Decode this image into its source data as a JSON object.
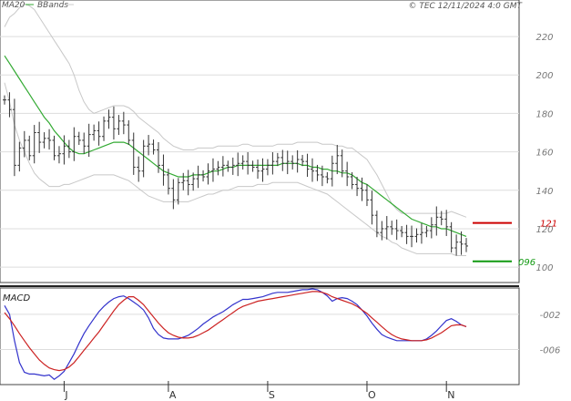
{
  "legend": {
    "ma20": "MA20",
    "bbands": "BBands"
  },
  "copyright": "© TEC 12/11/2024 4:0 GMT",
  "macd_title": "MACD",
  "colors": {
    "price": "#333333",
    "ma20": "#33aa33",
    "bbands": "#c8c8c8",
    "macd": "#3333cc",
    "signal": "#cc2222",
    "resistance": "#cc0000",
    "support": "#119911",
    "grid": "#dddddd"
  },
  "chart_data": [
    {
      "type": "ohlc",
      "title": "",
      "x_months": [
        "J",
        "A",
        "S",
        "O",
        "N"
      ],
      "ylim": [
        92,
        239
      ],
      "y_ticks": [
        "100",
        "120",
        "140",
        "160",
        "180",
        "200",
        "220"
      ],
      "grid": true,
      "legend_position": "top-left",
      "levels": [
        {
          "name": "resistance",
          "label": "121",
          "value": 123
        },
        {
          "name": "support",
          "label": "096",
          "value": 103
        }
      ],
      "closes": [
        187,
        182,
        153,
        162,
        166,
        158,
        170,
        165,
        167,
        166,
        158,
        159,
        163,
        160,
        168,
        166,
        163,
        169,
        171,
        168,
        176,
        178,
        172,
        176,
        174,
        166,
        152,
        150,
        163,
        164,
        161,
        153,
        148,
        141,
        135,
        144,
        145,
        143,
        146,
        148,
        147,
        150,
        151,
        152,
        153,
        152,
        153,
        154,
        155,
        153,
        152,
        150,
        151,
        153,
        155,
        157,
        154,
        155,
        154,
        156,
        155,
        151,
        150,
        148,
        147,
        146,
        154,
        158,
        150,
        147,
        143,
        141,
        140,
        135,
        127,
        118,
        120,
        121,
        120,
        119,
        118,
        116,
        116,
        117,
        118,
        119,
        122,
        126,
        125,
        121,
        110,
        113,
        112,
        111
      ],
      "ma20": [
        210,
        206,
        202,
        198,
        194,
        190,
        186,
        182,
        178,
        175,
        171,
        168,
        165,
        162,
        160,
        159,
        159,
        160,
        161,
        162,
        163,
        164,
        165,
        165,
        165,
        164,
        162,
        160,
        158,
        156,
        154,
        152,
        150,
        149,
        148,
        147,
        147,
        147,
        148,
        148,
        148,
        149,
        150,
        150,
        151,
        152,
        152,
        153,
        153,
        153,
        153,
        153,
        153,
        153,
        153,
        153,
        154,
        154,
        154,
        154,
        153,
        153,
        152,
        152,
        151,
        151,
        150,
        150,
        149,
        149,
        148,
        146,
        144,
        143,
        141,
        139,
        137,
        135,
        133,
        131,
        129,
        127,
        125,
        124,
        123,
        122,
        121,
        121,
        120,
        120,
        119,
        118,
        117,
        116
      ],
      "bb_upper": [
        225,
        230,
        232,
        235,
        237,
        236,
        234,
        230,
        226,
        222,
        218,
        214,
        210,
        206,
        200,
        192,
        186,
        182,
        180,
        181,
        182,
        183,
        184,
        184,
        184,
        183,
        181,
        178,
        176,
        174,
        172,
        170,
        167,
        165,
        163,
        162,
        161,
        161,
        161,
        162,
        162,
        162,
        162,
        163,
        163,
        163,
        163,
        163,
        164,
        164,
        163,
        163,
        163,
        163,
        163,
        164,
        164,
        164,
        164,
        165,
        165,
        165,
        165,
        165,
        164,
        164,
        164,
        163,
        163,
        162,
        162,
        160,
        158,
        156,
        152,
        148,
        143,
        138,
        133,
        130,
        128,
        128,
        128,
        128,
        128,
        128,
        128,
        128,
        128,
        128,
        129,
        128,
        127,
        126
      ],
      "bb_lower": [
        196,
        186,
        174,
        166,
        160,
        154,
        149,
        146,
        144,
        142,
        142,
        142,
        143,
        143,
        144,
        145,
        146,
        147,
        148,
        148,
        148,
        148,
        148,
        147,
        146,
        145,
        143,
        141,
        139,
        137,
        136,
        135,
        134,
        134,
        134,
        134,
        134,
        134,
        135,
        136,
        137,
        138,
        138,
        139,
        140,
        140,
        141,
        142,
        142,
        142,
        142,
        143,
        143,
        143,
        144,
        144,
        144,
        144,
        144,
        144,
        143,
        142,
        141,
        140,
        139,
        138,
        136,
        134,
        132,
        130,
        128,
        126,
        124,
        122,
        120,
        118,
        116,
        115,
        113,
        112,
        110,
        109,
        108,
        107,
        107,
        107,
        107,
        107,
        107,
        107,
        107,
        106,
        106,
        106
      ]
    },
    {
      "type": "line",
      "title": "MACD",
      "ylim": [
        -10,
        1
      ],
      "y_ticks": [
        "-002",
        "-006"
      ],
      "y_tick_values": [
        -2,
        -6
      ],
      "series": [
        {
          "name": "MACD",
          "values": [
            -1,
            -2,
            -5,
            -7.5,
            -8.6,
            -8.8,
            -8.8,
            -8.9,
            -9,
            -8.9,
            -9.4,
            -9,
            -8.5,
            -7.5,
            -6.5,
            -5.3,
            -4.2,
            -3.3,
            -2.5,
            -1.7,
            -1.1,
            -0.6,
            -0.2,
            0,
            0.1,
            -0.2,
            -0.6,
            -1,
            -1.5,
            -2.4,
            -3.6,
            -4.3,
            -4.7,
            -4.8,
            -4.8,
            -4.8,
            -4.6,
            -4.4,
            -4,
            -3.6,
            -3.1,
            -2.7,
            -2.3,
            -2,
            -1.7,
            -1.3,
            -0.9,
            -0.6,
            -0.3,
            -0.3,
            -0.2,
            -0.1,
            0,
            0.2,
            0.4,
            0.5,
            0.5,
            0.5,
            0.6,
            0.7,
            0.8,
            0.8,
            0.9,
            0.8,
            0.5,
            0.1,
            -0.5,
            -0.2,
            -0.1,
            -0.2,
            -0.5,
            -0.9,
            -1.5,
            -2.2,
            -3,
            -3.7,
            -4.3,
            -4.6,
            -4.8,
            -5,
            -5,
            -5,
            -5,
            -5,
            -5,
            -4.8,
            -4.4,
            -3.9,
            -3.3,
            -2.7,
            -2.5,
            -2.8,
            -3.2,
            -3.4
          ]
        },
        {
          "name": "Signal",
          "values": [
            -1.8,
            -2.5,
            -3.3,
            -4.2,
            -5,
            -5.8,
            -6.5,
            -7.2,
            -7.7,
            -8.1,
            -8.3,
            -8.4,
            -8.3,
            -8,
            -7.5,
            -6.8,
            -6.1,
            -5.4,
            -4.7,
            -4,
            -3.2,
            -2.4,
            -1.6,
            -0.9,
            -0.4,
            0,
            0,
            -0.4,
            -0.9,
            -1.6,
            -2.3,
            -3,
            -3.6,
            -4.1,
            -4.4,
            -4.6,
            -4.7,
            -4.7,
            -4.6,
            -4.4,
            -4.1,
            -3.8,
            -3.4,
            -3,
            -2.6,
            -2.2,
            -1.8,
            -1.4,
            -1.1,
            -0.9,
            -0.7,
            -0.5,
            -0.4,
            -0.3,
            -0.2,
            -0.1,
            0,
            0.1,
            0.2,
            0.3,
            0.4,
            0.5,
            0.6,
            0.6,
            0.5,
            0.3,
            0,
            -0.2,
            -0.4,
            -0.6,
            -0.8,
            -1.1,
            -1.5,
            -1.9,
            -2.4,
            -2.9,
            -3.4,
            -3.9,
            -4.3,
            -4.6,
            -4.8,
            -4.9,
            -5,
            -5,
            -5,
            -4.9,
            -4.7,
            -4.4,
            -4.1,
            -3.7,
            -3.3,
            -3.2,
            -3.2,
            -3.4
          ]
        }
      ]
    }
  ]
}
